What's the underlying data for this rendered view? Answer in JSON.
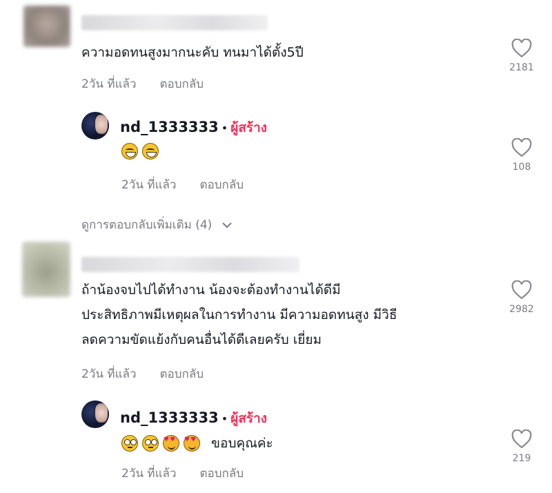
{
  "comments": [
    {
      "text": "ความอดทนสูงมากนะคับ ทนมาได้ตั้ง5ปี",
      "time": "2วัน ที่แล้ว",
      "reply_label": "ตอบกลับ",
      "likes": "2181",
      "reply": {
        "username": "nd_1333333",
        "separator": "•",
        "creator_badge": "ผู้สร้าง",
        "emojis": [
          "grinning-sweat-emoji",
          "grinning-sweat-emoji"
        ],
        "text": "",
        "time": "2วัน ที่แล้ว",
        "reply_label": "ตอบกลับ",
        "likes": "108"
      },
      "more_replies": "ดูการตอบกลับเพิ่มเติม (4)"
    },
    {
      "lines": [
        "ถ้าน้องจบไปได้ทำงาน น้องจะต้องทำงานได้ดีมี",
        "ประสิทธิภาพมีเหตุผลในการทำงาน มีความอดทนสูง มีวิธี",
        "ลดความขัดแย้งกับคนอื่นได้ดีเลยครับ เยี่ยม"
      ],
      "time": "2วัน ที่แล้ว",
      "reply_label": "ตอบกลับ",
      "likes": "2982",
      "reply": {
        "username": "nd_1333333",
        "separator": "•",
        "creator_badge": "ผู้สร้าง",
        "emojis": [
          "flushed-face-emoji",
          "flushed-face-emoji",
          "smiling-hearts-emoji",
          "smiling-hearts-emoji"
        ],
        "text": "ขอบคุณค่ะ",
        "time": "2วัน ที่แล้ว",
        "reply_label": "ตอบกลับ",
        "likes": "219"
      }
    }
  ],
  "colors": {
    "creator": "#fe2c55",
    "meta": "#7a7b82",
    "text": "#161823"
  }
}
